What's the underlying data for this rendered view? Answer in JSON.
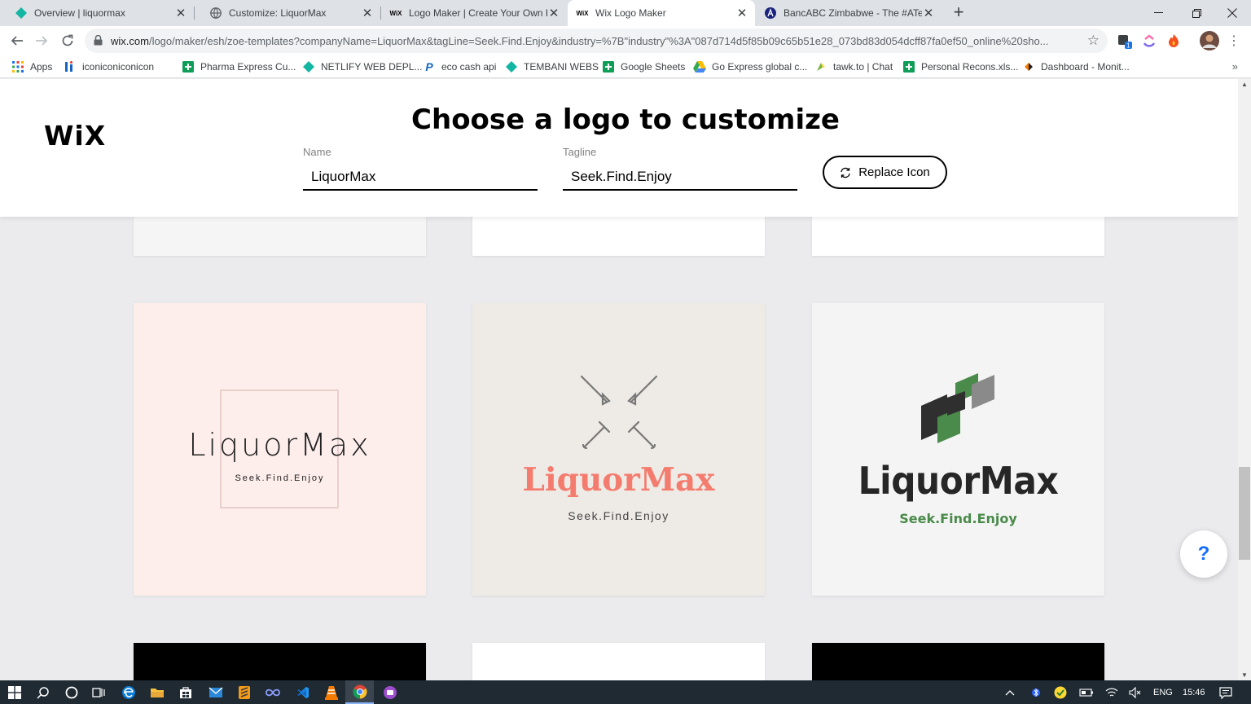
{
  "browser": {
    "tabs": [
      {
        "title": "Overview | liquormax",
        "icon": "diamond-icon",
        "active": false
      },
      {
        "title": "Customize: LiquorMax",
        "icon": "globe-icon",
        "active": false
      },
      {
        "title": "Logo Maker | Create Your Own Fr",
        "icon": "wix-icon",
        "active": false
      },
      {
        "title": "Wix Logo Maker",
        "icon": "wix-icon",
        "active": true
      },
      {
        "title": "BancABC Zimbabwe - The #ATear",
        "icon": "a-icon",
        "active": false
      }
    ],
    "url_host": "wix.com",
    "url_path": "/logo/maker/esh/zoe-templates?companyName=LiquorMax&tagLine=Seek.Find.Enjoy&industry=%7B\"industry\"%3A\"087d714d5f85b09c65b51e28_073bd83d054dcff87fa0ef50_online%20sho...",
    "extension_badge": "1",
    "bookmarks": [
      {
        "label": "Apps",
        "icon": "apps-grid-icon"
      },
      {
        "label": "iconiconiconicon",
        "icon": "iconify-icon"
      },
      {
        "label": "Pharma Express Cu...",
        "icon": "sheets-icon"
      },
      {
        "label": "NETLIFY WEB DEPL...",
        "icon": "diamond-icon"
      },
      {
        "label": "eco cash api",
        "icon": "paypal-icon"
      },
      {
        "label": "TEMBANI WEBS",
        "icon": "diamond-icon"
      },
      {
        "label": "Google Sheets",
        "icon": "sheets-icon"
      },
      {
        "label": "Go Express global c...",
        "icon": "drive-icon"
      },
      {
        "label": "tawk.to | Chat",
        "icon": "tawk-icon"
      },
      {
        "label": "Personal Recons.xls...",
        "icon": "sheets-icon"
      },
      {
        "label": "Dashboard - Monit...",
        "icon": "dashboard-icon"
      }
    ]
  },
  "header": {
    "brand": "WiX",
    "title": "Choose a logo to customize",
    "name_label": "Name",
    "name_value": "LiquorMax",
    "tagline_label": "Tagline",
    "tagline_value": "Seek.Find.Enjoy",
    "replace_icon_label": "Replace Icon"
  },
  "logos": [
    {
      "name": "LiquorMax",
      "tagline": "Seek.Find.Enjoy",
      "background": "#fdeeec",
      "style": "thin-frame"
    },
    {
      "name": "LiquorMax",
      "tagline": "Seek.Find.Enjoy",
      "background": "#eeebe6",
      "style": "crossed-tools",
      "name_color": "#f47c6e"
    },
    {
      "name": "LiquorMax",
      "tagline": "Seek.Find.Enjoy",
      "background": "#f4f4f4",
      "style": "parallelograms",
      "tagline_color": "#4a8a4a"
    }
  ],
  "help_label": "?",
  "taskbar": {
    "language": "ENG",
    "time": "15:46"
  }
}
